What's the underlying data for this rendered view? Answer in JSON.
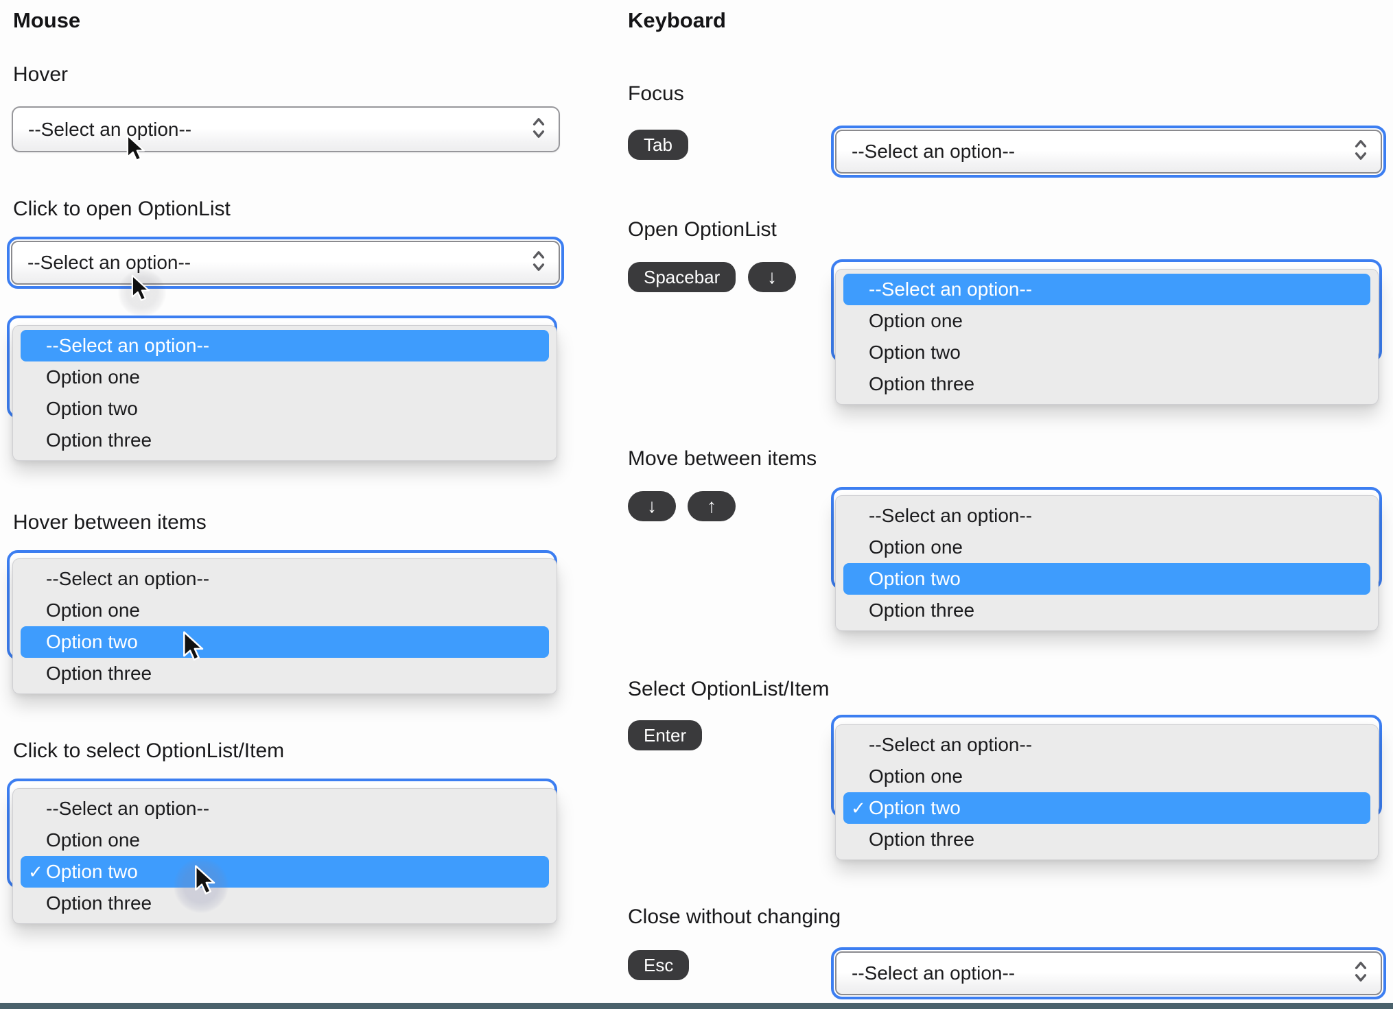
{
  "placeholder": "--Select an option--",
  "options": [
    "--Select an option--",
    "Option one",
    "Option two",
    "Option three"
  ],
  "checkmark": "✓",
  "colors": {
    "focus_ring": "#3C7EF1",
    "selection_highlight": "#3E9CFD",
    "key_badge_bg": "#3A3A3C",
    "panel_bg": "#EBEBEB",
    "select_border": "#97979B",
    "bottom_bar": "#4A616B"
  },
  "mouse": {
    "title": "Mouse",
    "sections": {
      "hover": {
        "label": "Hover"
      },
      "click_open": {
        "label": "Click to open OptionList"
      },
      "hover_items": {
        "label": "Hover between items"
      },
      "click_select": {
        "label": "Click to select OptionList/Item"
      }
    }
  },
  "keyboard": {
    "title": "Keyboard",
    "sections": {
      "focus": {
        "label": "Focus",
        "keys": [
          "Tab"
        ]
      },
      "open": {
        "label": "Open OptionList",
        "keys": [
          "Spacebar",
          "↓"
        ]
      },
      "move": {
        "label": "Move between items",
        "keys": [
          "↓",
          "↑"
        ]
      },
      "select": {
        "label": "Select OptionList/Item",
        "keys": [
          "Enter"
        ]
      },
      "close": {
        "label": "Close without changing",
        "keys": [
          "Esc"
        ]
      }
    }
  }
}
